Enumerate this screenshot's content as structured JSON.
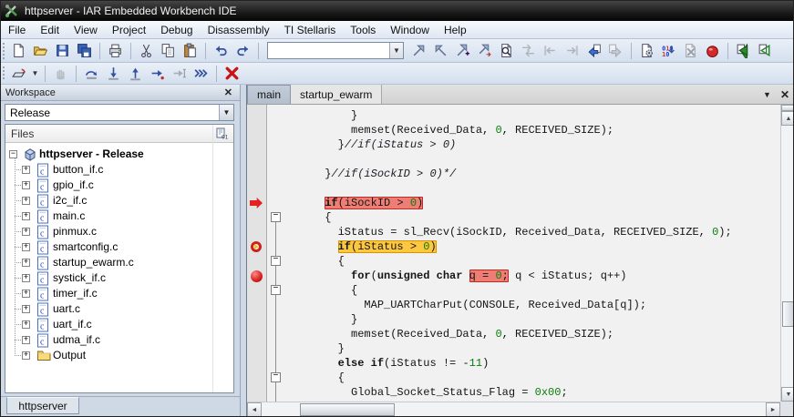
{
  "window": {
    "title": "httpserver - IAR Embedded Workbench IDE"
  },
  "menu": [
    "File",
    "Edit",
    "View",
    "Project",
    "Debug",
    "Disassembly",
    "TI Stellaris",
    "Tools",
    "Window",
    "Help"
  ],
  "toolbar_main": {
    "find_value": "",
    "items": [
      {
        "icon": "new-document"
      },
      {
        "icon": "open"
      },
      {
        "icon": "save"
      },
      {
        "icon": "save-all"
      },
      {
        "sep": true
      },
      {
        "icon": "print"
      },
      {
        "sep": true
      },
      {
        "icon": "cut"
      },
      {
        "icon": "copy"
      },
      {
        "icon": "paste"
      },
      {
        "sep": true
      },
      {
        "icon": "undo"
      },
      {
        "icon": "redo"
      },
      {
        "sep": true
      },
      {
        "combo": true
      },
      {
        "icon": "find-next"
      },
      {
        "icon": "find-previous"
      },
      {
        "icon": "bookmark-add"
      },
      {
        "icon": "bookmark-next"
      },
      {
        "icon": "find-in-files"
      },
      {
        "icon": "replace",
        "disabled": true
      },
      {
        "icon": "goto-previous",
        "disabled": true
      },
      {
        "icon": "goto-next",
        "disabled": true
      },
      {
        "icon": "navigate-backward"
      },
      {
        "icon": "navigate-forward",
        "disabled": true
      },
      {
        "sep": true
      },
      {
        "icon": "compile"
      },
      {
        "icon": "make"
      },
      {
        "icon": "stop-build",
        "disabled": true
      },
      {
        "icon": "toggle-breakpoint"
      },
      {
        "sep": true
      },
      {
        "icon": "download-and-debug"
      },
      {
        "icon": "debug-without-downloading"
      }
    ]
  },
  "toolbar_debug": {
    "items": [
      {
        "icon": "reset"
      },
      {
        "dropdown": true
      },
      {
        "sep": true
      },
      {
        "icon": "break",
        "disabled": true
      },
      {
        "sep": true
      },
      {
        "icon": "step-over"
      },
      {
        "icon": "step-into"
      },
      {
        "icon": "step-out"
      },
      {
        "icon": "next-statement"
      },
      {
        "icon": "run-to-cursor",
        "disabled": true
      },
      {
        "icon": "go"
      },
      {
        "sep": true
      },
      {
        "icon": "stop-debugging"
      }
    ]
  },
  "workspace": {
    "title": "Workspace",
    "config": "Release",
    "files_header": "Files",
    "bottom_tab": "httpserver",
    "tree": [
      {
        "label": "httpserver - Release",
        "icon": "project",
        "expander": "minus",
        "bold": true,
        "level": 0
      },
      {
        "label": "button_if.c",
        "icon": "cfile",
        "expander": "plus",
        "level": 1
      },
      {
        "label": "gpio_if.c",
        "icon": "cfile",
        "expander": "plus",
        "level": 1
      },
      {
        "label": "i2c_if.c",
        "icon": "cfile",
        "expander": "plus",
        "level": 1
      },
      {
        "label": "main.c",
        "icon": "cfile",
        "expander": "plus",
        "level": 1
      },
      {
        "label": "pinmux.c",
        "icon": "cfile",
        "expander": "plus",
        "level": 1
      },
      {
        "label": "smartconfig.c",
        "icon": "cfile",
        "expander": "plus",
        "level": 1
      },
      {
        "label": "startup_ewarm.c",
        "icon": "cfile",
        "expander": "plus",
        "level": 1
      },
      {
        "label": "systick_if.c",
        "icon": "cfile",
        "expander": "plus",
        "level": 1
      },
      {
        "label": "timer_if.c",
        "icon": "cfile",
        "expander": "plus",
        "level": 1
      },
      {
        "label": "uart.c",
        "icon": "cfile",
        "expander": "plus",
        "level": 1
      },
      {
        "label": "uart_if.c",
        "icon": "cfile",
        "expander": "plus",
        "level": 1
      },
      {
        "label": "udma_if.c",
        "icon": "cfile",
        "expander": "plus",
        "level": 1
      },
      {
        "label": "Output",
        "icon": "folder",
        "expander": "plus",
        "level": 1
      }
    ]
  },
  "editor": {
    "tabs": [
      {
        "label": "main",
        "active": true
      },
      {
        "label": "startup_ewarm",
        "active": false
      }
    ],
    "colors": {
      "breakpoint_highlight": "#ee7e74",
      "pc_highlight": "#fcc842",
      "number": "#0a7d0a"
    },
    "code": {
      "lines": [
        {
          "segs": [
            {
              "t": "          }"
            }
          ]
        },
        {
          "segs": [
            {
              "t": "          memset(Received_Data, "
            },
            {
              "t": "0",
              "n": 1
            },
            {
              "t": ", RECEIVED_SIZE);"
            }
          ]
        },
        {
          "segs": [
            {
              "t": "        }"
            },
            {
              "t": "//if(iStatus > 0)",
              "c": 1
            }
          ]
        },
        {
          "segs": []
        },
        {
          "segs": [
            {
              "t": "      }"
            },
            {
              "t": "//if(iSockID > 0)*/",
              "c": 1
            }
          ]
        },
        {
          "segs": []
        },
        {
          "marker": "bp-arrow",
          "segs": [
            {
              "t": "      "
            },
            {
              "h": "r",
              "parts": [
                {
                  "t": "if",
                  "k": 1
                },
                {
                  "t": "(iSockID > "
                },
                {
                  "t": "0",
                  "n": 1
                },
                {
                  "t": ")"
                }
              ]
            }
          ]
        },
        {
          "fold": true,
          "segs": [
            {
              "t": "      {"
            }
          ]
        },
        {
          "segs": [
            {
              "t": "        iStatus = sl_Recv(iSockID, Received_Data, RECEIVED_SIZE, "
            },
            {
              "t": "0",
              "n": 1
            },
            {
              "t": ");"
            }
          ]
        },
        {
          "marker": "pc",
          "segs": [
            {
              "t": "        "
            },
            {
              "h": "o",
              "parts": [
                {
                  "t": "if",
                  "k": 1
                },
                {
                  "t": "(iStatus > "
                },
                {
                  "t": "0",
                  "n": 1
                },
                {
                  "t": ")"
                }
              ]
            }
          ]
        },
        {
          "fold": true,
          "segs": [
            {
              "t": "        {"
            }
          ]
        },
        {
          "marker": "bp",
          "segs": [
            {
              "t": "          "
            },
            {
              "t": "for",
              "k": 1
            },
            {
              "t": "("
            },
            {
              "t": "unsigned char",
              "k": 1
            },
            {
              "t": " "
            },
            {
              "h": "r",
              "parts": [
                {
                  "t": "q = "
                },
                {
                  "t": "0",
                  "n": 1
                },
                {
                  "t": ";"
                }
              ]
            },
            {
              "t": " q < iStatus; q++)"
            }
          ]
        },
        {
          "fold": true,
          "segs": [
            {
              "t": "          {"
            }
          ]
        },
        {
          "segs": [
            {
              "t": "            MAP_UARTCharPut(CONSOLE, Received_Data[q]);"
            }
          ]
        },
        {
          "segs": [
            {
              "t": "          }"
            }
          ]
        },
        {
          "segs": [
            {
              "t": "          memset(Received_Data, "
            },
            {
              "t": "0",
              "n": 1
            },
            {
              "t": ", RECEIVED_SIZE);"
            }
          ]
        },
        {
          "segs": [
            {
              "t": "        }"
            }
          ]
        },
        {
          "segs": [
            {
              "t": "        "
            },
            {
              "t": "else if",
              "k": 1
            },
            {
              "t": "(iStatus != -"
            },
            {
              "t": "11",
              "n": 1
            },
            {
              "t": ")"
            }
          ]
        },
        {
          "fold": true,
          "segs": [
            {
              "t": "        {"
            }
          ]
        },
        {
          "segs": [
            {
              "t": "          Global_Socket_Status_Flag = "
            },
            {
              "t": "0x00",
              "n": 1
            },
            {
              "t": ";"
            }
          ]
        }
      ]
    }
  }
}
